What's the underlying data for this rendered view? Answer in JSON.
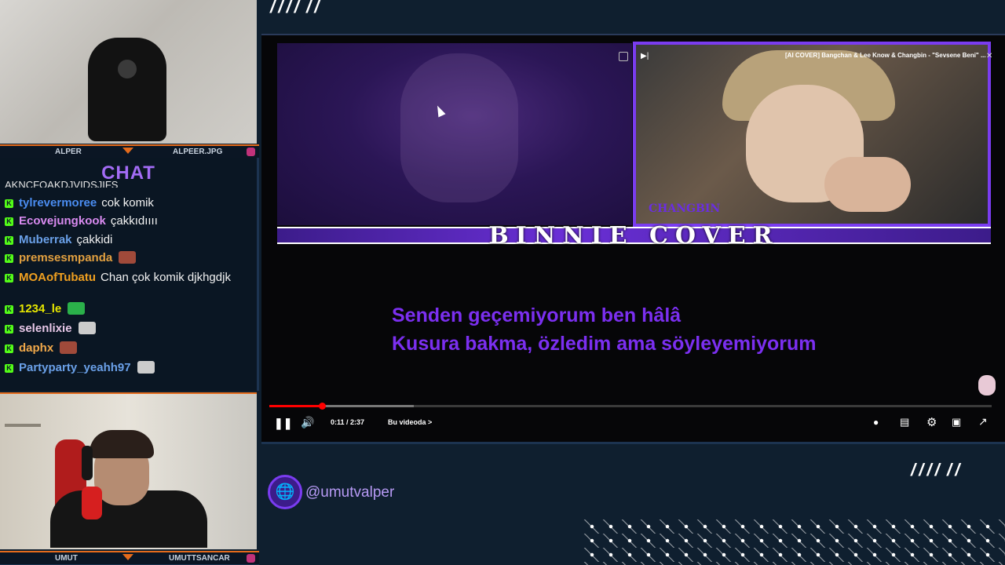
{
  "webcam_top": {
    "left_name": "ALPER",
    "right_name": "ALPEER.JPG"
  },
  "chat": {
    "title": "CHAT",
    "cut_line": "AKNCFOAKDJVIDSJIFS",
    "badge_letter": "K",
    "messages": [
      {
        "user": "tylrevermoree",
        "user_color": "#4a8cf0",
        "text": "cok komik",
        "emote": ""
      },
      {
        "user": "Ecovejungkook",
        "user_color": "#d98bf0",
        "text": "çakkıdıııı",
        "emote": ""
      },
      {
        "user": "Muberrak",
        "user_color": "#6aa0e8",
        "text": "çakkidi",
        "emote": ""
      },
      {
        "user": "premsesmpanda",
        "user_color": "#e2a040",
        "text": "",
        "emote": "#a04a3a"
      },
      {
        "user": "MOAofTubatu",
        "user_color": "#f0a020",
        "text": "Chan çok komik djkhgdjk",
        "emote": ""
      },
      {
        "user": "1234_le",
        "user_color": "#e6e600",
        "text": "",
        "emote": "#2bb04a"
      },
      {
        "user": "selenlixie",
        "user_color": "#e8c8e8",
        "text": "",
        "emote": "#cccccc"
      },
      {
        "user": "daphx",
        "user_color": "#f0a84a",
        "text": "",
        "emote": "#a04a3a"
      },
      {
        "user": "Partyparty_yeahh97",
        "user_color": "#6aa0e8",
        "text": "",
        "emote": "#cccccc"
      }
    ]
  },
  "webcam_bottom": {
    "left_name": "UMUT",
    "right_name": "UMUTTSANCAR"
  },
  "video": {
    "pip_title": "[AI COVER] Bangchan & Lee Know & Changbin - \"Sevsene Beni\" ...",
    "pip_caption": "CHANGBIN",
    "banner": "BINNIE COVER",
    "lyrics": [
      "Senden geçemiyorum ben hâlâ",
      "Kusura bakma, özledim ama söyleyemiyorum"
    ],
    "progress_fraction": 0.0733,
    "buffered_fraction": 0.2,
    "time": "0:11 / 2:37",
    "chapter": "Bu videoda",
    "chapter_arrow": ">",
    "icons": [
      "pause-icon",
      "volume-icon",
      "autoplay-toggle-icon",
      "subtitles-icon",
      "settings-icon",
      "miniplayer-icon",
      "fullscreen-icon"
    ]
  },
  "social": {
    "handle": "@umutvalper",
    "icon": "globe-icon"
  },
  "colors": {
    "accent_purple": "#7a3cf0",
    "accent_orange": "#e46b1c",
    "kick_green": "#53fc18",
    "progress_red": "#ff0000"
  }
}
